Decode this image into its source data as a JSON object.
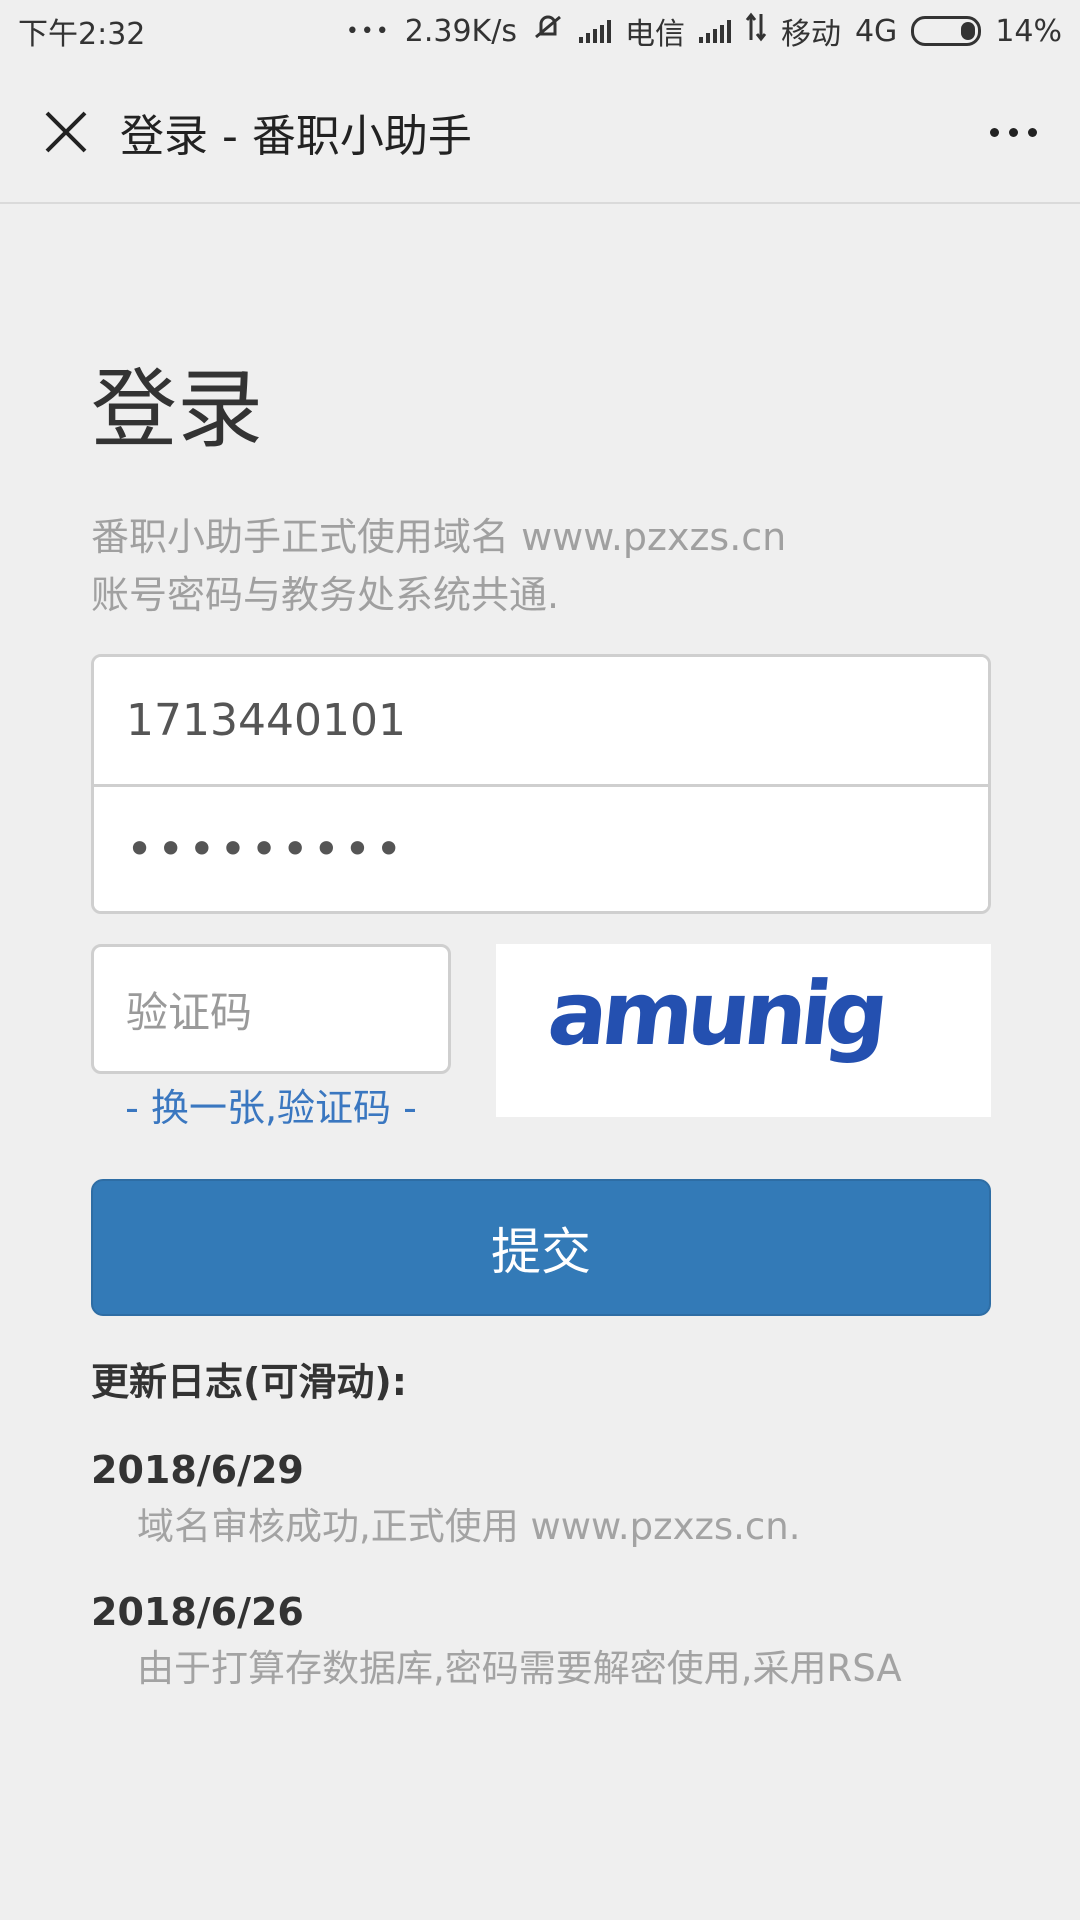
{
  "status_bar": {
    "time": "下午2:32",
    "dots": "•••",
    "speed": "2.39K/s",
    "carrier1": "电信",
    "carrier2": "移动",
    "network": "4G",
    "battery": "14%"
  },
  "header": {
    "title": "登录 - 番职小助手",
    "close_icon": "close-icon",
    "more_icon": "more-icon"
  },
  "main": {
    "title": "登录",
    "subtitle_line1": "番职小助手正式使用域名 www.pzxzs.cn",
    "subtitle_line2": "账号密码与教务处系统共通.",
    "username_value": "1713440101",
    "password_mask": "•••••••••",
    "captcha_placeholder": "验证码",
    "refresh_link": "- 换一张,验证码 -",
    "captcha_text": "amunig",
    "submit_label": "提交"
  },
  "changelog": {
    "title": "更新日志(可滑动):",
    "entries": [
      {
        "date": "2018/6/29",
        "text": "域名审核成功,正式使用 www.pzxzs.cn."
      },
      {
        "date": "2018/6/26",
        "text": "由于打算存数据库,密码需要解密使用,采用RSA"
      }
    ]
  },
  "colors": {
    "accent": "#337ab7",
    "link": "#3a77c0",
    "captcha": "#2450b0"
  }
}
